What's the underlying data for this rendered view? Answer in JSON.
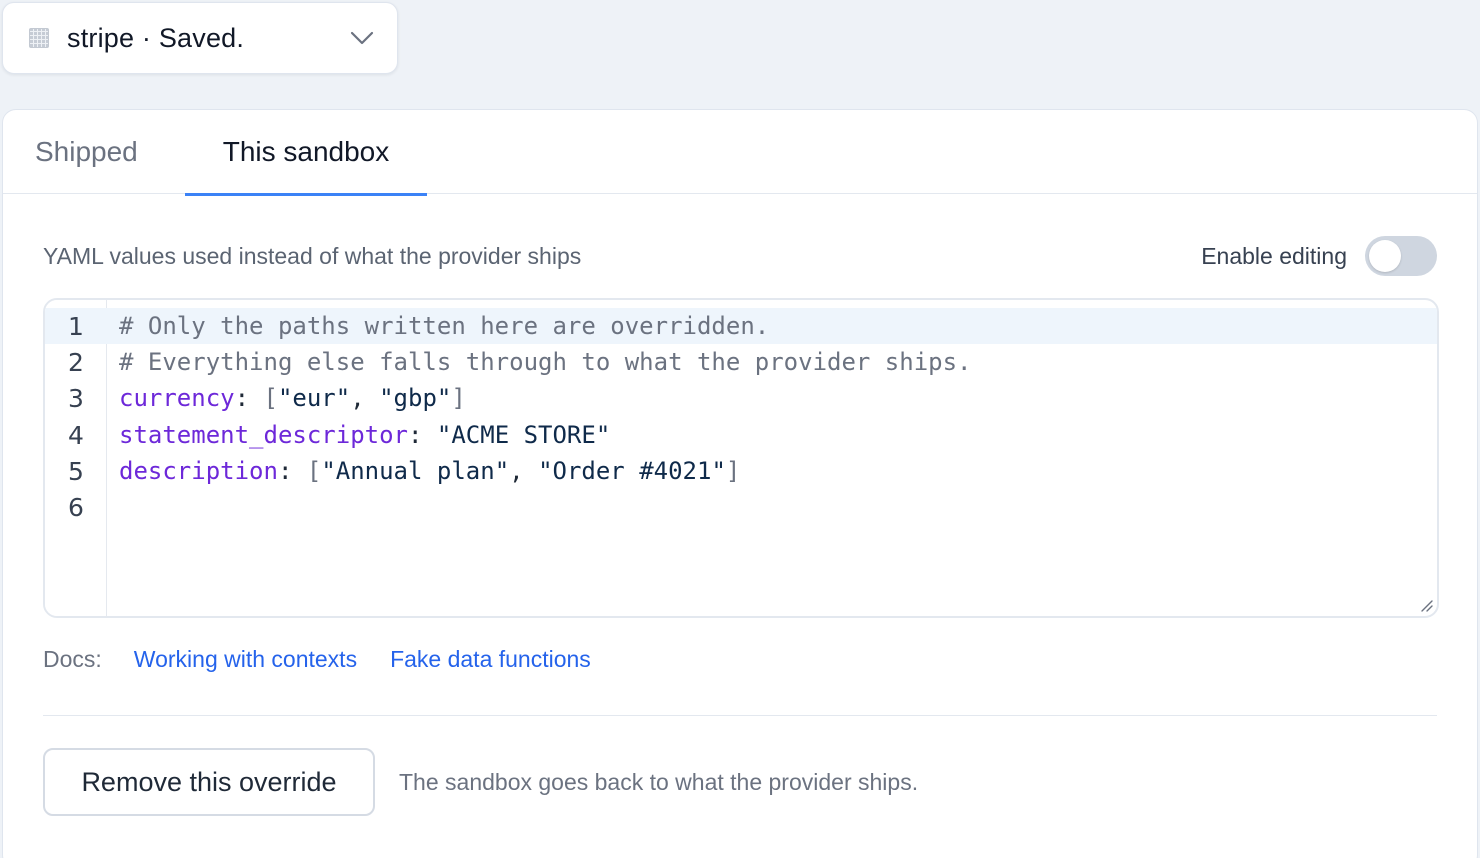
{
  "selector": {
    "text": "stripe · Saved.",
    "icon": "grid-icon",
    "chevron_icon": "chevron-down-icon"
  },
  "tabs": [
    {
      "label": "Shipped",
      "active": false
    },
    {
      "label": "This sandbox",
      "active": true
    }
  ],
  "panel": {
    "description": "YAML values used instead of what the provider ships",
    "enable_label": "Enable editing",
    "enable_on": false
  },
  "editor": {
    "line_numbers": [
      "1",
      "2",
      "3",
      "4",
      "5",
      "6"
    ],
    "lines": {
      "l1": "# Only the paths written here are overridden.",
      "l2": "# Everything else falls through to what the provider ships.",
      "l3_key": "currency",
      "l3_a": "\"eur\"",
      "l3_b": "\"gbp\"",
      "l4_key": "statement_descriptor",
      "l4_val": "\"ACME STORE\"",
      "l5_key": "description",
      "l5_a": "\"Annual plan\"",
      "l5_b": "\"Order #4021\""
    }
  },
  "docs": {
    "label": "Docs:",
    "links": [
      "Working with contexts",
      "Fake data functions"
    ]
  },
  "footer": {
    "remove_label": "Remove this override",
    "note": "The sandbox goes back to what the provider ships."
  },
  "colors": {
    "accent": "#3b82f6",
    "link": "#2563eb",
    "yaml_key": "#6d28d9"
  }
}
